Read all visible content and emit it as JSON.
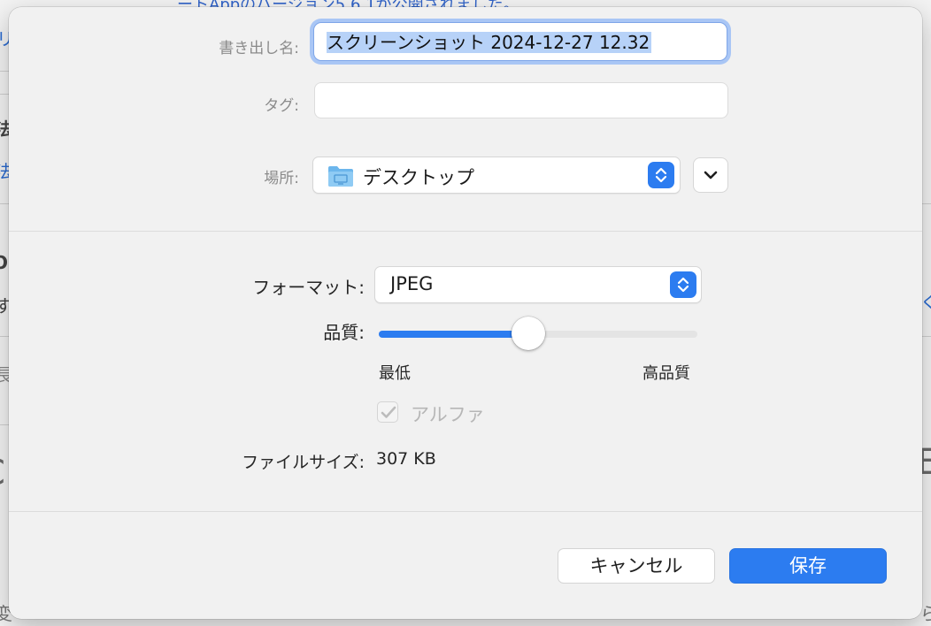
{
  "background_app": {
    "top_fragment": "ートAppのバージョン5.6.1が公開されました。",
    "left_fragments": [
      "リ",
      "法",
      "法",
      "O",
      "す",
      "長",
      "C",
      "変"
    ],
    "right_fragments": [
      "く",
      "E",
      "ら"
    ]
  },
  "dialog": {
    "export_name": {
      "label": "書き出し名:",
      "value": "スクリーンショット 2024-12-27 12.32"
    },
    "tags": {
      "label": "タグ:",
      "value": ""
    },
    "location": {
      "label": "場所:",
      "value": "デスクトップ",
      "folder_icon": "folder-icon",
      "expand_icon": "chevron-down-icon"
    },
    "format": {
      "label": "フォーマット:",
      "value": "JPEG"
    },
    "quality": {
      "label": "品質:",
      "level": 0.47,
      "min_label": "最低",
      "max_label": "高品質"
    },
    "alpha": {
      "label": "アルファ",
      "checked": true,
      "enabled": false
    },
    "file_size": {
      "label": "ファイルサイズ:",
      "value": "307 KB"
    },
    "buttons": {
      "cancel": "キャンセル",
      "save": "保存"
    }
  },
  "colors": {
    "accent": "#2c7cf0",
    "selection": "#b7d2f8",
    "focus_ring": "#a9c6f5"
  }
}
